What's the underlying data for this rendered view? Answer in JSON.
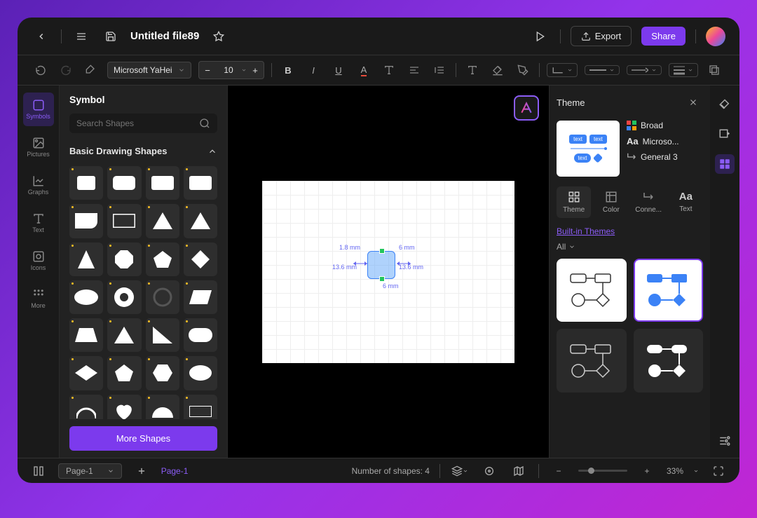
{
  "titlebar": {
    "filename": "Untitled file89",
    "export_label": "Export",
    "share_label": "Share"
  },
  "toolbar": {
    "font": "Microsoft YaHei",
    "font_size": "10"
  },
  "left_rail": {
    "items": [
      {
        "label": "Symbols",
        "active": true
      },
      {
        "label": "Pictures"
      },
      {
        "label": "Graphs"
      },
      {
        "label": "Text"
      },
      {
        "label": "Icons"
      },
      {
        "label": "More"
      }
    ]
  },
  "shapes_panel": {
    "title": "Symbol",
    "search_placeholder": "Search Shapes",
    "section_title": "Basic Drawing Shapes",
    "more_button": "More Shapes"
  },
  "canvas": {
    "dim_top": "1.8 mm",
    "dim_top_right": "6 mm",
    "dim_left": "13.6 mm",
    "dim_right": "13.6 mm",
    "dim_bottom": "6 mm"
  },
  "theme_panel": {
    "title": "Theme",
    "preview_text": "text",
    "meta_color": "Broad",
    "meta_font": "Microso...",
    "meta_connector": "General 3",
    "tabs": [
      {
        "label": "Theme",
        "active": true
      },
      {
        "label": "Color"
      },
      {
        "label": "Conne..."
      },
      {
        "label": "Text"
      }
    ],
    "builtin_label": "Built-in Themes",
    "filter_label": "All"
  },
  "statusbar": {
    "page_selector": "Page-1",
    "page_link": "Page-1",
    "shape_count": "Number of shapes: 4",
    "zoom": "33%"
  }
}
